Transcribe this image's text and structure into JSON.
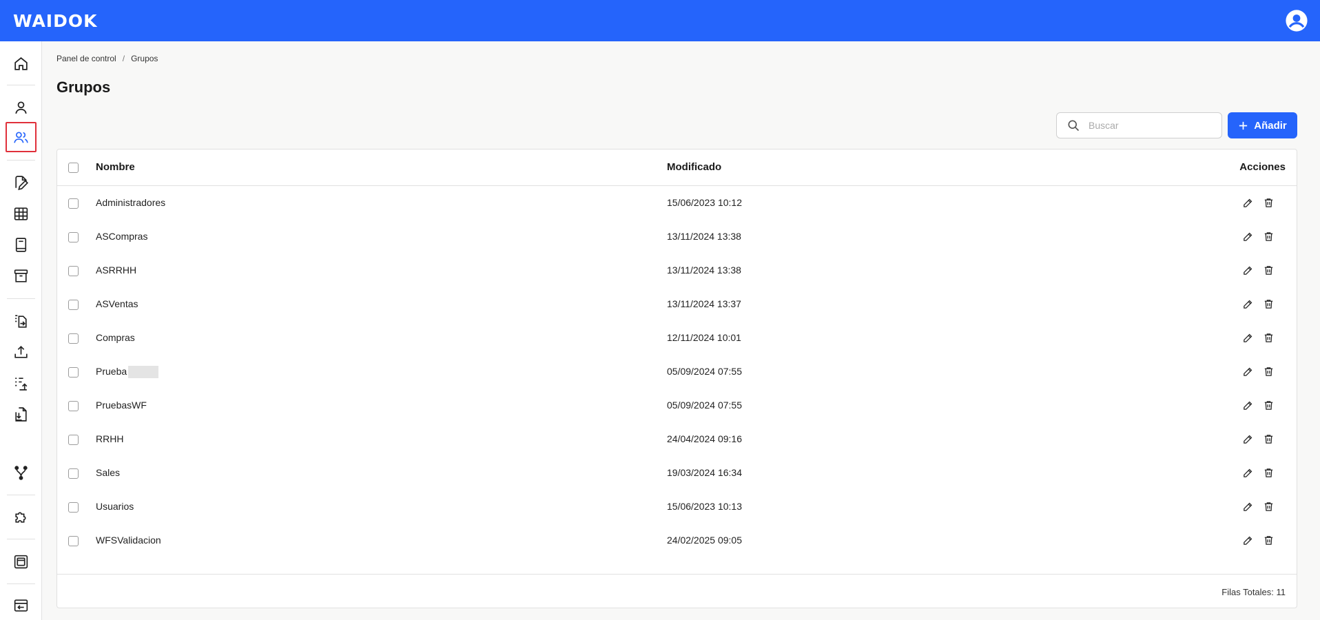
{
  "header": {
    "logo": "WAIDOK"
  },
  "breadcrumb": {
    "root": "Panel de control",
    "separator": "/",
    "current": "Grupos"
  },
  "page": {
    "title": "Grupos"
  },
  "search": {
    "placeholder": "Buscar"
  },
  "toolbar": {
    "add_label": "Añadir"
  },
  "table": {
    "columns": {
      "name": "Nombre",
      "modified": "Modificado",
      "actions": "Acciones"
    },
    "rows": [
      {
        "name": "Administradores",
        "modified": "15/06/2023 10:12"
      },
      {
        "name": "ASCompras",
        "modified": "13/11/2024 13:38"
      },
      {
        "name": "ASRRHH",
        "modified": "13/11/2024 13:38"
      },
      {
        "name": "ASVentas",
        "modified": "13/11/2024 13:37"
      },
      {
        "name": "Compras",
        "modified": "12/11/2024 10:01"
      },
      {
        "name": "Prueba",
        "modified": "05/09/2024 07:55"
      },
      {
        "name": "PruebasWF",
        "modified": "05/09/2024 07:55"
      },
      {
        "name": "RRHH",
        "modified": "24/04/2024 09:16"
      },
      {
        "name": "Sales",
        "modified": "19/03/2024 16:34"
      },
      {
        "name": "Usuarios",
        "modified": "15/06/2023 10:13"
      },
      {
        "name": "WFSValidacion",
        "modified": "24/02/2025 09:05"
      }
    ],
    "footer": "Filas Totales: 11"
  },
  "sidebar_icons": [
    "home-icon",
    "user-icon",
    "users-icon",
    "document-edit-icon",
    "table-icon",
    "book-icon",
    "archive-icon",
    "file-move-icon",
    "upload-icon",
    "list-upload-icon",
    "file-download-icon",
    "workflow-icon",
    "plugin-icon",
    "layout-icon",
    "import-icon"
  ],
  "colors": {
    "primary": "#2564fb",
    "active_border": "#e0303a"
  }
}
